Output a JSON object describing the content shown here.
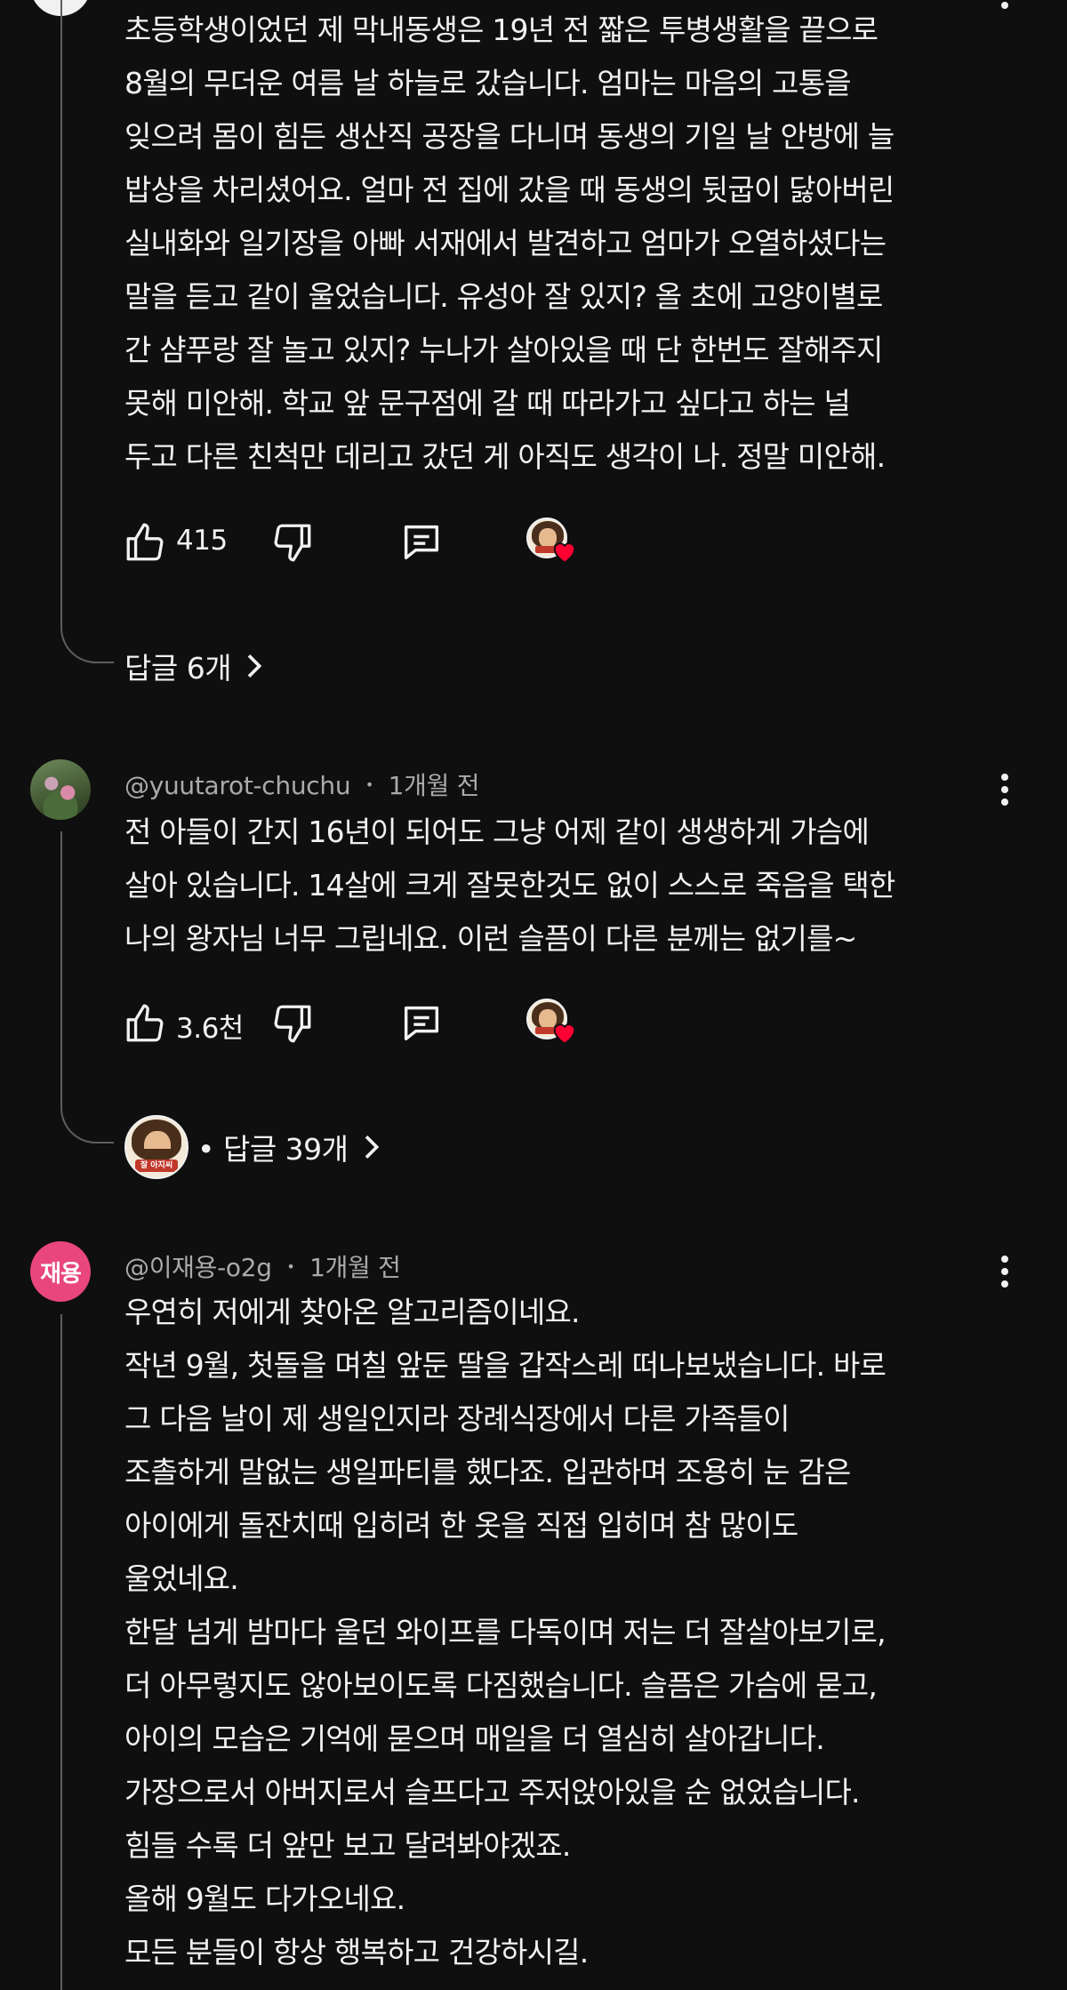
{
  "comments": [
    {
      "text_lines": [
        "초등학생이었던 제 막내동생은 19년 전 짧은 투병생활을 끝으로",
        "8월의 무더운 여름 날 하늘로 갔습니다. 엄마는 마음의 고통을",
        "잊으려 몸이 힘든 생산직 공장을 다니며 동생의 기일 날 안방에 늘",
        "밥상을 차리셨어요. 얼마 전 집에 갔을 때 동생의 뒷굽이 닳아버린",
        "실내화와 일기장을 아빠 서재에서 발견하고 엄마가 오열하셨다는",
        "말을 듣고 같이 울었습니다. 유성아 잘 있지? 올 초에 고양이별로",
        "간 샴푸랑 잘 놀고 있지? 누나가 살아있을 때 단 한번도 잘해주지",
        "못해 미안해. 학교 앞 문구점에 갈 때 따라가고 싶다고 하는 널",
        "두고 다른 친척만 데리고 갔던 게 아직도 생각이 나. 정말 미안해."
      ],
      "like_count": "415",
      "replies_label": "답글 6개"
    },
    {
      "author": "@yuutarot-chuchu",
      "time": "1개월 전",
      "separator": "•",
      "text_lines": [
        "전 아들이 간지 16년이 되어도 그냥 어제 같이 생생하게 가슴에",
        "살아 있습니다. 14살에 크게 잘못한것도 없이 스스로 죽음을 택한",
        "나의 왕자님 너무 그립네요. 이런 슬픔이 다른 분께는 없기를~"
      ],
      "like_count": "3.6천",
      "replies_label": "• 답글 39개",
      "reply_avatar_tag": "잘 아지씨"
    },
    {
      "author": "@이재용-o2g",
      "time": "1개월 전",
      "separator": "•",
      "avatar_letters": "재용",
      "avatar_color": "#e8467c",
      "text_lines": [
        "우연히 저에게 찾아온 알고리즘이네요.",
        "작년 9월, 첫돌을 며칠 앞둔 딸을 갑작스레 떠나보냈습니다. 바로",
        "그 다음 날이 제 생일인지라 장례식장에서 다른 가족들이",
        "조촐하게 말없는 생일파티를 했다죠. 입관하며 조용히 눈 감은",
        "아이에게 돌잔치때 입히려 한 옷을 직접 입히며 참 많이도",
        "울었네요.",
        "한달 넘게 밤마다 울던 와이프를 다독이며 저는 더 잘살아보기로,",
        "더 아무렇지도 않아보이도록 다짐했습니다. 슬픔은 가슴에 묻고,",
        "아이의 모습은 기억에 묻으며 매일을 더 열심히 살아갑니다.",
        "가장으로서 아버지로서 슬프다고 주저앉아있을 순 없었습니다.",
        "힘들 수록 더 앞만 보고 달려봐야겠죠.",
        "올해 9월도 다가오네요.",
        "모든 분들이 항상 행복하고 건강하시길."
      ]
    }
  ],
  "icons": {
    "like": "thumb-up-icon",
    "dislike": "thumb-down-icon",
    "reply": "comment-icon",
    "creator_heart": "creator-heart-icon",
    "more": "more-vertical-icon",
    "chevron": "chevron-right-icon"
  },
  "colors": {
    "background": "#0f0f0f",
    "text": "#f1f1f1",
    "secondary_text": "#aaaaaa",
    "heart": "#ff0033"
  }
}
